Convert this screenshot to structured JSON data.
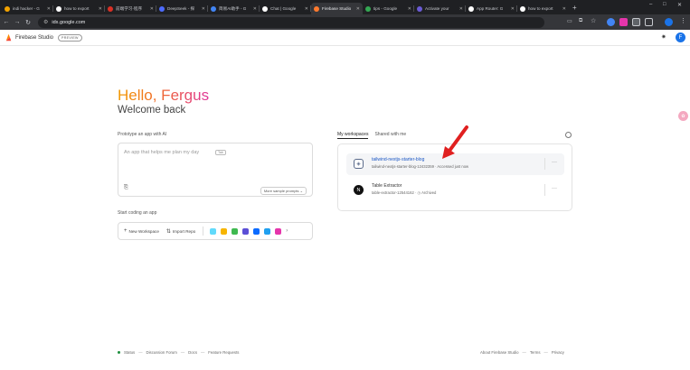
{
  "browser": {
    "tabs": [
      {
        "label": "indi hacker - G",
        "color": "#f4a300"
      },
      {
        "label": "how to export",
        "color": "#ffffff"
      },
      {
        "label": "前端学习-程序",
        "color": "#d93025"
      },
      {
        "label": "DeepSeek - 探",
        "color": "#4d6bfe"
      },
      {
        "label": "简易AI助手 - G",
        "color": "#4285f4"
      },
      {
        "label": "Chat | Google",
        "color": "#ffffff"
      },
      {
        "label": "Firebase Studio",
        "color": "#ff7a2e"
      },
      {
        "label": "tips - Google",
        "color": "#34a853"
      },
      {
        "label": "Activate your",
        "color": "#6b5bd6"
      },
      {
        "label": "App Router: G",
        "color": "#ffffff"
      },
      {
        "label": "how to export",
        "color": "#ffffff"
      }
    ],
    "active_tab_index": 6,
    "url": "idx.google.com",
    "new_tab": "+",
    "window_minimize": "–",
    "window_maximize": "□"
  },
  "app": {
    "brand": "Firebase Studio",
    "badge": "PREVIEW",
    "avatar_initial": "F",
    "theme_icon": "✷"
  },
  "greeting": {
    "hello": "Hello, Fergus",
    "welcome": "Welcome back"
  },
  "prototype": {
    "label": "Prototype an app with AI",
    "placeholder": "An app that helps me plan my day",
    "tab_key": "Tab",
    "more_prompts": "More sample prompts ⌄"
  },
  "coding": {
    "label": "Start coding an app",
    "new_workspace": "New Workspace",
    "import_repo": "Import Repo",
    "template_colors": [
      "#61dafb",
      "#f7b500",
      "#3fb950",
      "#5b4fd6",
      "#0b6bff",
      "#20a0f0",
      "#e535ab"
    ]
  },
  "workspaces": {
    "tab_mine": "My workspaces",
    "tab_shared": "Shared with me",
    "items": [
      {
        "name": "tailwind-nextjs-starter-blog",
        "meta": "tailwind-nextjs-starter-blog-12432359 · Accessed just now",
        "icon": "◈",
        "more": "···"
      },
      {
        "name": "Table Extractor",
        "meta": "table-extractor-12544162 · ◷ Archived",
        "icon": "N",
        "more": "···"
      }
    ]
  },
  "footer": {
    "status": "Status",
    "forum": "Discussion Forum",
    "docs": "Docs",
    "feature": "Feature Requests",
    "about": "About Firebase Studio",
    "terms": "Terms",
    "privacy": "Privacy"
  },
  "colors": {
    "accent": "#1a73e8",
    "arrow": "#e02020",
    "status_green": "#1e8e3e"
  }
}
